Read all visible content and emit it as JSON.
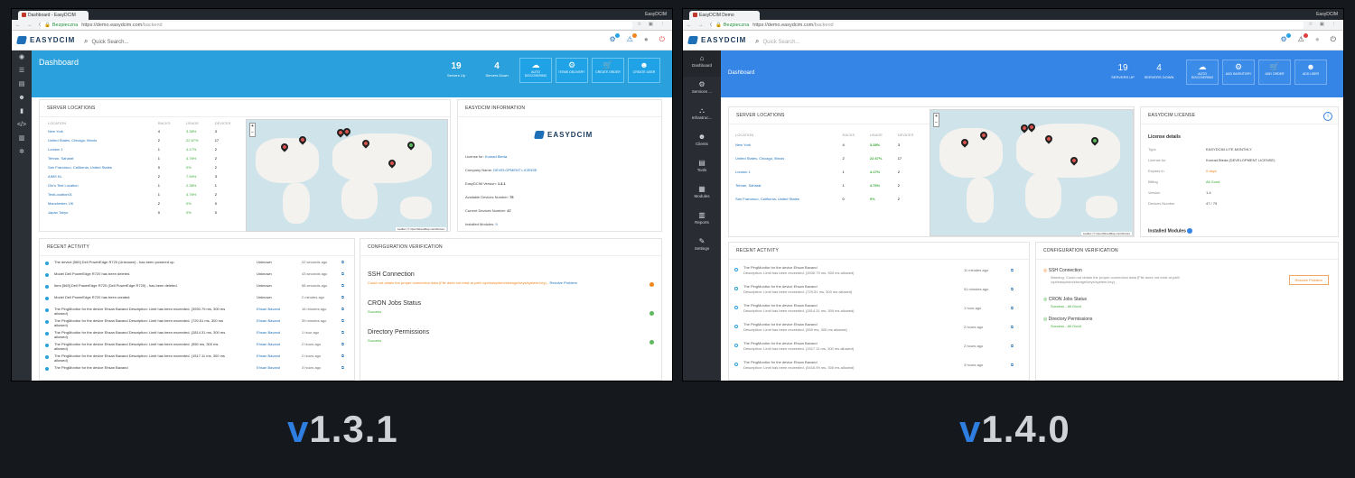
{
  "left": {
    "tab_title": "Dashboard - EasyDCIM",
    "window_label": "EasyDCIM",
    "url_secure": "Bezpieczna",
    "url_host": "https://demo.easydcim.com",
    "url_path": "/backend",
    "logo": "EASYDCIM",
    "search_placeholder": "Quick Search...",
    "page_title": "Dashboard",
    "stats": [
      {
        "n": "19",
        "l": "Servers Up"
      },
      {
        "n": "4",
        "l": "Servers Down"
      }
    ],
    "tiles": [
      "AUTO DISCOVERING",
      "ITEMS DELIVERY",
      "CREATE ORDER",
      "CREATE USER"
    ],
    "locations_title": "SERVER LOCATIONS",
    "loc_headers": [
      "LOCATION",
      "RACKS",
      "USAGE",
      "DEVICES"
    ],
    "locations": [
      [
        "New York",
        "4",
        "3.38%",
        "3"
      ],
      [
        "United States, Chicago, Illinois",
        "2",
        "22.67%",
        "17"
      ],
      [
        "London 1",
        "1",
        "4.17%",
        "2"
      ],
      [
        "Tehran, Saharat",
        "1",
        "4.76%",
        "2"
      ],
      [
        "San Francisco, California, United States",
        "0",
        "0%",
        "2"
      ],
      [
        "AIMS KL",
        "2",
        "7.69%",
        "3"
      ],
      [
        "Glo's Test Location",
        "1",
        "2.38%",
        "1"
      ],
      [
        "TestLocation01",
        "1",
        "4.76%",
        "2"
      ],
      [
        "Manchester, UK",
        "2",
        "0%",
        "0"
      ],
      [
        "Japan Tokyo",
        "0",
        "0%",
        "0"
      ]
    ],
    "info_title": "EASYDCIM INFORMATION",
    "info": {
      "license_label": "License for:",
      "license_value": "Konrad Bieda",
      "company_label": "Company Name:",
      "company_value": "DEVELOPMENT LICENSE",
      "version_label": "EasyDCIM Version:",
      "version_value": "1.3.1",
      "available_label": "Available Devices Number:",
      "available_value": "75",
      "current_label": "Current Devices Number:",
      "current_value": "47",
      "modules_label": "Installed Modules:",
      "modules_value": "9"
    },
    "activity_title": "RECENT ACTIVITY",
    "activity": [
      {
        "t": "The device [569] Dell PowerEdge R720 (Unknown) - has been powered up.",
        "who": "Unknown",
        "when": "22 seconds ago"
      },
      {
        "t": "Model Dell PowerEdge R720 has been deleted.",
        "who": "Unknown",
        "when": "43 seconds ago"
      },
      {
        "t": "Item [569] Dell PowerEdge R720 (Dell PowerEdge R720) - has been deleted.",
        "who": "Unknown",
        "when": "58 seconds ago"
      },
      {
        "t": "Model Dell PowerEdge R720 has been created.",
        "who": "Unknown",
        "when": "2 minutes ago"
      },
      {
        "t": "The PingMonitor for the device Ehsan Bavand Description: Limit has been exceeded. (3930.79 ms, 300 ms allowed)",
        "who": "Ehsan Bavand",
        "when": "16 minutes ago"
      },
      {
        "t": "The PingMonitor for the device Ehsan Bavand Description: Limit has been exceeded. (729.51 ms, 300 ms allowed)",
        "who": "Ehsan Bavand",
        "when": "39 minutes ago"
      },
      {
        "t": "The PingMonitor for the device Ehsan Bavand Description: Limit has been exceeded. (2814.31 ms, 300 ms allowed)",
        "who": "Ehsan Bavand",
        "when": "1 hour ago"
      },
      {
        "t": "The PingMonitor for the device Ehsan Bavand Description: Limit has been exceeded. (559 ms, 300 ms allowed)",
        "who": "Ehsan Bavand",
        "when": "2 hours ago"
      },
      {
        "t": "The PingMonitor for the device Ehsan Bavand Description: Limit has been exceeded. (1517.11 ms, 300 ms allowed)",
        "who": "Ehsan Bavand",
        "when": "2 hours ago"
      },
      {
        "t": "The PingMonitor for the device Ehsan Bavand",
        "who": "Ehsan Bavand",
        "when": "3 hours ago"
      }
    ],
    "config_title": "CONFIGURATION VERIFICATION",
    "config": {
      "ssh_h": "SSH Connection",
      "ssh_w": "Could not obtain the proper connection data (File does not exist at path /opt/easydcim/storage/keys/system.key) -",
      "ssh_link": "Resolve Problem",
      "cron_h": "CRON Jobs Status",
      "cron_s": "Success",
      "dir_h": "Directory Permissions",
      "dir_s": "Success"
    },
    "map_attrib": "Leaflet | © OpenStreetMap contributors",
    "version_v": "v",
    "version_rest": "1.3.1"
  },
  "right": {
    "tab_title": "EasyDCIM Demo",
    "window_label": "EasyDCIM",
    "url_secure": "Bezpieczna",
    "url_host": "https://demo.easydcim.com",
    "url_path": "/backend",
    "logo": "EASYDCIM",
    "search_placeholder": "Quick Search...",
    "nav": [
      "Dashboard",
      "Services ...",
      "Infrastruc...",
      "Clients",
      "Tools",
      "Modules",
      "Reports",
      "Settings"
    ],
    "page_title": "Dashboard",
    "stats": [
      {
        "n": "19",
        "l": "SERVERS UP"
      },
      {
        "n": "4",
        "l": "SERVERS DOWN"
      }
    ],
    "tiles": [
      "AUTO DISCOVERING",
      "ADD INVENTORY",
      "ADD ORDER",
      "ADD USER"
    ],
    "locations_title": "SERVER LOCATIONS",
    "loc_headers": [
      "LOCATION",
      "RACKS",
      "USAGE",
      "DEVICES"
    ],
    "locations": [
      [
        "New York",
        "4",
        "3.38%",
        "3"
      ],
      [
        "United States, Chicago, Illinois",
        "2",
        "22.67%",
        "17"
      ],
      [
        "London 1",
        "1",
        "4.17%",
        "2"
      ],
      [
        "Tehran, Saharat",
        "1",
        "4.76%",
        "2"
      ],
      [
        "San Francisco, California, United States",
        "0",
        "0%",
        "2"
      ]
    ],
    "license_title": "EASYDCIM LICENSE",
    "license_details": "License details",
    "license": [
      [
        "Type",
        "EASYDCIM LITE MONTHLY"
      ],
      [
        "License for",
        "Konrad Bieda (DEVELOPMENT LICENSE)"
      ],
      [
        "Expires in",
        "0 days"
      ],
      [
        "Billing",
        "All Good"
      ],
      [
        "Version",
        "1.4"
      ],
      [
        "Devices Number",
        "47 / 75"
      ]
    ],
    "installed_modules": "Installed Modules",
    "activity_title": "RECENT ACTIVITY",
    "activity": [
      {
        "t": "The PingMonitor for the device Ehsan Bavand",
        "d": "Description: Limit has been exceeded. (3930.79 ms, 300 ms allowed)",
        "when": "11 minutes ago"
      },
      {
        "t": "The PingMonitor for the device Ehsan Bavand",
        "d": "Description: Limit has been exceeded. (729.51 ms, 300 ms allowed)",
        "when": "51 minutes ago"
      },
      {
        "t": "The PingMonitor for the device Ehsan Bavand",
        "d": "Description: Limit has been exceeded. (2814.31 ms, 300 ms allowed)",
        "when": "1 hour ago"
      },
      {
        "t": "The PingMonitor for the device Ehsan Bavand",
        "d": "Description: Limit has been exceeded. (559 ms, 300 ms allowed)",
        "when": "2 hours ago"
      },
      {
        "t": "The PingMonitor for the device Ehsan Bavand",
        "d": "Description: Limit has been exceeded. (1517.11 ms, 300 ms allowed)",
        "when": "2 hours ago"
      },
      {
        "t": "The PingMonitor for the device Ehsan Bavand",
        "d": "Description: Limit has been exceeded. (5416.99 ms, 300 ms allowed)",
        "when": "3 hours ago"
      }
    ],
    "config_title": "CONFIGURATION VERIFICATION",
    "config": {
      "ssh_h": "SSH Connection",
      "ssh_w": "Warning: Could not obtain the proper connection data (File does not exist at path /opt/easydcim/storage/keys/system.key) -",
      "resolve": "Resolve Problem",
      "cron_h": "CRON Jobs Status",
      "cron_s": "Success - All Good",
      "dir_h": "Directory Permissions",
      "dir_s": "Success - All Good"
    },
    "map_attrib": "Leaflet | © OpenStreetMap contributors",
    "version_v": "v",
    "version_rest": "1.4.0"
  },
  "colors": {
    "accent": "#2aa1dc",
    "accent_new": "#3585e6",
    "success": "#3aaa35",
    "warning": "#f0861d",
    "sidebar": "#2b3036"
  }
}
